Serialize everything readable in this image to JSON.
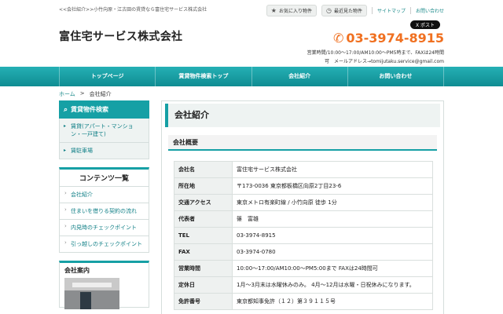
{
  "header": {
    "topline": "<<会社紹介>>小竹向原・江古田の賃貸なら富住宅サービス株式会社",
    "favorites_label": "お気に入り物件",
    "recent_label": "最近見た物件",
    "sitemap_label": "サイトマップ",
    "contact_label": "お問い合わせ",
    "logo": "富住宅サービス株式会社",
    "x_post_label": "X ポスト",
    "phone": "03-3974-8915",
    "hours": "営業時間/10:00〜17:00/AM10:00〜PM5時まで、FAXは24時間",
    "email": "可　メールアドレス→tomijutaku.service@gmail.com"
  },
  "nav": {
    "items": [
      "トップページ",
      "賃貸物件検索トップ",
      "会社紹介",
      "お問い合わせ"
    ]
  },
  "breadcrumb": {
    "home": "ホーム",
    "sep": ">",
    "current": "会社紹介"
  },
  "sidebar": {
    "search_title": "賃貸物件検索",
    "property_items": [
      "賃貸(アパート・マンション・一戸建て)",
      "賃駐車場"
    ],
    "contents_title": "コンテンツ一覧",
    "contents_items": [
      "会社紹介",
      "住まいを借りる契約の流れ",
      "内見時のチェックポイント",
      "引っ越しのチェックポイント"
    ],
    "info_title": "会社案内"
  },
  "main": {
    "title": "会社紹介",
    "subtitle": "会社概要",
    "rows": [
      {
        "label": "会社名",
        "value": "富住宅サービス株式会社"
      },
      {
        "label": "所在地",
        "value": "〒173-0036 東京都板橋区向原2丁目23-6"
      },
      {
        "label": "交通アクセス",
        "value": "東京メトロ有楽町線 / 小竹向原 徒歩 1分"
      },
      {
        "label": "代表者",
        "value": "篠　富雄"
      },
      {
        "label": "TEL",
        "value": "03-3974-8915"
      },
      {
        "label": "FAX",
        "value": "03-3974-0780"
      },
      {
        "label": "営業時間",
        "value": "10:00〜17:00/AM10:00〜PM5:00まで FAXは24時間可"
      },
      {
        "label": "定休日",
        "value": "1月〜3月末は水曜休みのみ。 4月〜12月は水曜・日祝休みになります。"
      },
      {
        "label": "免許番号",
        "value": "東京都知事免許（１２）第３９１１５号"
      }
    ]
  },
  "colors": {
    "accent": "#16a0a5",
    "phone": "#f07020"
  }
}
